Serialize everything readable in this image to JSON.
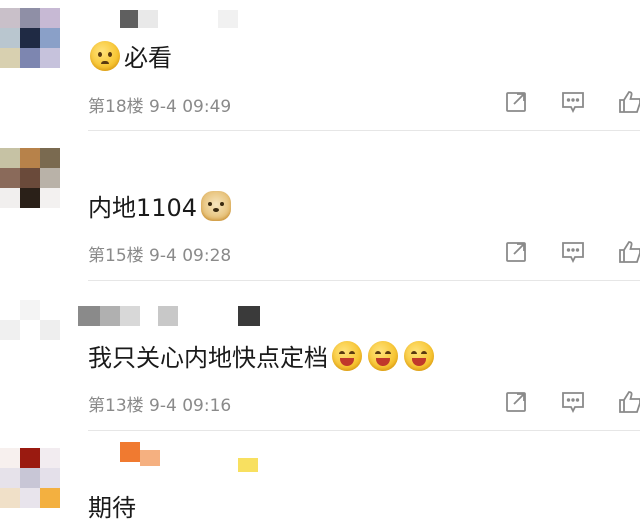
{
  "comments": [
    {
      "content": "必看",
      "floor": "第18楼",
      "time": "9-4 09:49",
      "emoji_before": "sad-face-emoji",
      "emoji_after": []
    },
    {
      "content": "内地1104",
      "floor": "第15楼",
      "time": "9-4 09:28",
      "emoji_before": null,
      "emoji_after": [
        "doge-emoji"
      ]
    },
    {
      "content": "我只关心内地快点定档",
      "floor": "第13楼",
      "time": "9-4 09:16",
      "emoji_before": null,
      "emoji_after": [
        "grin-emoji",
        "grin-emoji",
        "grin-emoji"
      ]
    },
    {
      "content": "期待",
      "floor": "",
      "time": "",
      "emoji_before": null,
      "emoji_after": []
    }
  ],
  "icons": {
    "share": "share-icon",
    "reply": "comment-icon",
    "like": "thumbs-up-icon"
  },
  "colors": {
    "text": "#1a1a1a",
    "meta": "#8a8a8a",
    "icon": "#8a8a8a",
    "divider": "#e6e6e6"
  }
}
